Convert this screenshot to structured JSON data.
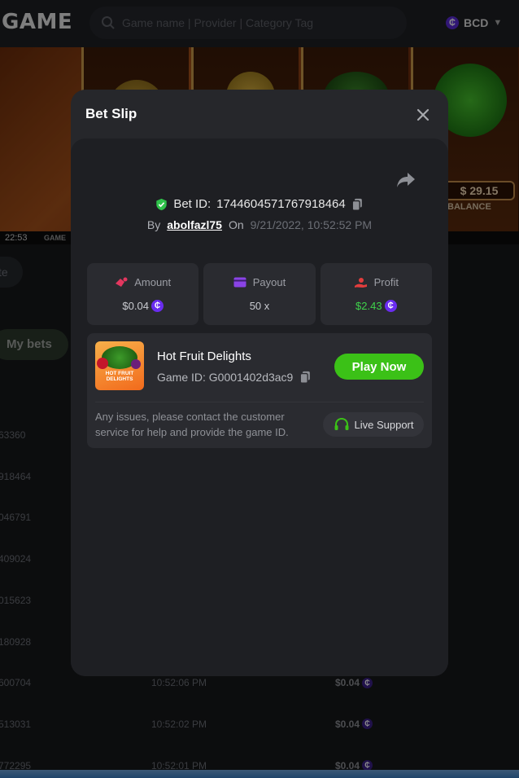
{
  "header": {
    "logo": "GAME",
    "search_placeholder": "Game name | Provider | Category Tag",
    "currency": "BCD",
    "currency_symbol": "₵"
  },
  "banner": {
    "balance": "$ 29.15",
    "balance_label": "BALANCE",
    "time": "22:53",
    "game_label": "GAME"
  },
  "background": {
    "filter_pill": "te",
    "my_bets": "My bets",
    "rows": [
      {
        "id": "63360",
        "time": "",
        "amount": ""
      },
      {
        "id": "918464",
        "time": "",
        "amount": ""
      },
      {
        "id": "046791",
        "time": "",
        "amount": ""
      },
      {
        "id": "409024",
        "time": "",
        "amount": ""
      },
      {
        "id": "015623",
        "time": "",
        "amount": ""
      },
      {
        "id": "180928",
        "time": "",
        "amount": ""
      },
      {
        "id": "600704",
        "time": "10:52:06 PM",
        "amount": "$0.04"
      },
      {
        "id": "513031",
        "time": "10:52:02 PM",
        "amount": "$0.04"
      },
      {
        "id": "772295",
        "time": "10:52:01 PM",
        "amount": "$0.04"
      }
    ]
  },
  "modal": {
    "title": "Bet Slip",
    "bet_id_label": "Bet ID:",
    "bet_id": "1744604571767918464",
    "by_label": "By",
    "username": "abolfazl75",
    "on_label": "On",
    "date": "9/21/2022, 10:52:52 PM",
    "stats": [
      {
        "label": "Amount",
        "value": "$0.04",
        "coin": true,
        "color": "#c9cbd0"
      },
      {
        "label": "Payout",
        "value": "50 x",
        "coin": false,
        "color": "#c9cbd0"
      },
      {
        "label": "Profit",
        "value": "$2.43",
        "coin": true,
        "color": "#3fd34b"
      }
    ],
    "game": {
      "name": "Hot Fruit Delights",
      "id_label": "Game ID:",
      "id": "G0001402d3ac9",
      "thumb_text": "HOT FRUIT DELIGHTS",
      "play_label": "Play Now"
    },
    "issue_text": "Any issues, please contact the customer service for help and provide the game ID.",
    "support_label": "Live Support"
  },
  "colors": {
    "accent_green": "#3bc117",
    "profit_green": "#3fd34b",
    "coin_purple": "#6a2cf0",
    "shield_green": "#2fc24a"
  }
}
